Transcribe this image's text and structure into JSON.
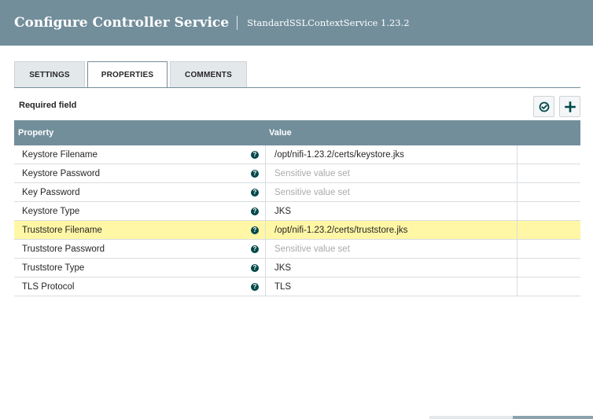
{
  "dialog": {
    "title": "Configure Controller Service",
    "subtitle": "StandardSSLContextService 1.23.2"
  },
  "tabs": [
    {
      "label": "SETTINGS",
      "active": false
    },
    {
      "label": "PROPERTIES",
      "active": true
    },
    {
      "label": "COMMENTS",
      "active": false
    }
  ],
  "required_field_label": "Required field",
  "toolbar": {
    "verify_icon": "check-circle-icon",
    "add_icon": "plus-icon"
  },
  "grid": {
    "headers": {
      "property": "Property",
      "value": "Value"
    },
    "rows": [
      {
        "property": "Keystore Filename",
        "value": "/opt/nifi-1.23.2/certs/keystore.jks",
        "sensitive": false
      },
      {
        "property": "Keystore Password",
        "value": "Sensitive value set",
        "sensitive": true
      },
      {
        "property": "Key Password",
        "value": "Sensitive value set",
        "sensitive": true
      },
      {
        "property": "Keystore Type",
        "value": "JKS",
        "sensitive": false
      },
      {
        "property": "Truststore Filename",
        "value": "/opt/nifi-1.23.2/certs/truststore.jks",
        "sensitive": false,
        "selected": true
      },
      {
        "property": "Truststore Password",
        "value": "Sensitive value set",
        "sensitive": true
      },
      {
        "property": "Truststore Type",
        "value": "JKS",
        "sensitive": false
      },
      {
        "property": "TLS Protocol",
        "value": "TLS",
        "sensitive": false
      }
    ]
  },
  "help_icon_glyph": "?",
  "colors": {
    "header_bg": "#728e9b",
    "selected_row": "#fff7a5",
    "help_icon": "#004849"
  }
}
